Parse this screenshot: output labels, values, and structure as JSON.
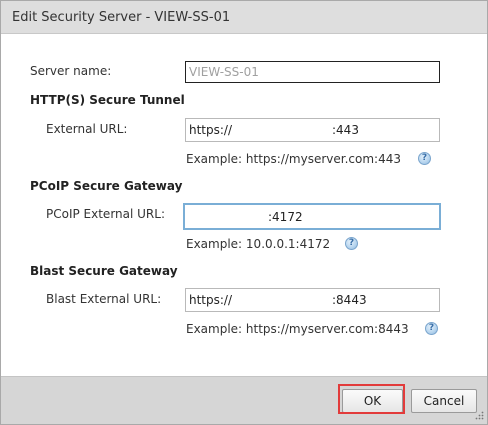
{
  "dialog": {
    "title": "Edit Security Server - VIEW-SS-01"
  },
  "server": {
    "name_label": "Server name:",
    "name_value": "VIEW-SS-01"
  },
  "http_tunnel": {
    "heading": "HTTP(S) Secure Tunnel",
    "url_label": "External URL:",
    "url_prefix": "https://",
    "url_suffix": ":443",
    "example": "Example: https://myserver.com:443",
    "help_icon": "question-circle-icon"
  },
  "pcoip_gateway": {
    "heading": "PCoIP Secure Gateway",
    "url_label": "PCoIP External URL:",
    "url_suffix": ":4172",
    "example": "Example: 10.0.0.1:4172",
    "help_icon": "question-circle-icon"
  },
  "blast_gateway": {
    "heading": "Blast Secure Gateway",
    "url_label": "Blast External URL:",
    "url_prefix": "https://",
    "url_suffix": ":8443",
    "example": "Example: https://myserver.com:8443",
    "help_icon": "question-circle-icon"
  },
  "footer": {
    "ok_label": "OK",
    "cancel_label": "Cancel",
    "resize_icon": "resize-grip-icon"
  },
  "colors": {
    "highlight": "#e23b3b",
    "focus_border": "#7aaed6",
    "titlebar_bg": "#dedede",
    "footer_bg": "#d6d6d6"
  }
}
